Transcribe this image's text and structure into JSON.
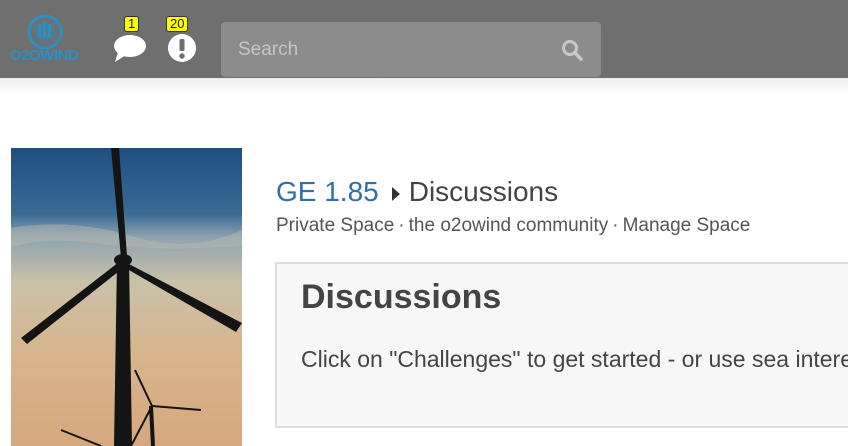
{
  "header": {
    "logo_text": "O2OWIND",
    "messages_count": "1",
    "notifications_count": "20",
    "search_placeholder": "Search",
    "colors": {
      "bar": "#6f6f6f",
      "badge": "#ffff00",
      "logo_blue": "#2a8fc1"
    }
  },
  "space": {
    "name": "GE 1.85",
    "section": "Discussions",
    "type": "Private Space",
    "community": "the o2owind community",
    "manage": "Manage Space"
  },
  "panel": {
    "heading": "Discussions",
    "body": "Click on \"Challenges\" to get started - or use sea interest."
  },
  "icons": [
    "chat-bubble-icon",
    "alert-icon",
    "search-icon",
    "chevron-right-icon"
  ]
}
